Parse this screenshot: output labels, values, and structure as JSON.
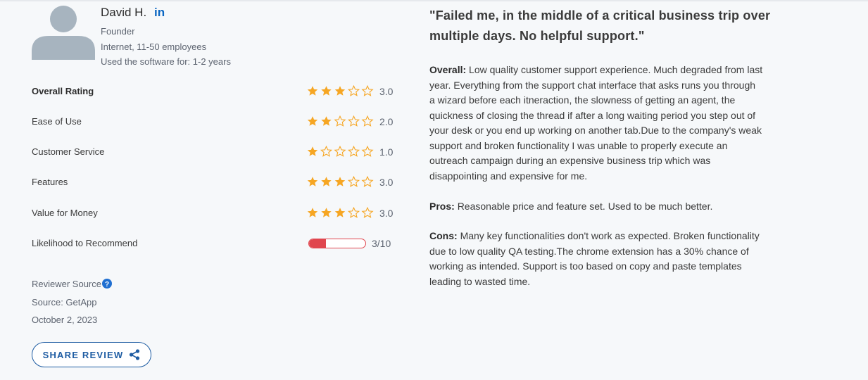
{
  "reviewer": {
    "name": "David H.",
    "linkedin_icon": "in",
    "role": "Founder",
    "company": "Internet, 11-50 employees",
    "usage": "Used the software for: 1-2 years"
  },
  "ratings": [
    {
      "label": "Overall Rating",
      "stars": 3,
      "value": "3.0"
    },
    {
      "label": "Ease of Use",
      "stars": 2,
      "value": "2.0"
    },
    {
      "label": "Customer Service",
      "stars": 1,
      "value": "1.0"
    },
    {
      "label": "Features",
      "stars": 3,
      "value": "3.0"
    },
    {
      "label": "Value for Money",
      "stars": 3,
      "value": "3.0"
    }
  ],
  "likelihood": {
    "label": "Likelihood to Recommend",
    "value": "3/10",
    "fraction": 0.3
  },
  "source": {
    "label": "Reviewer Source",
    "source_text": "Source: GetApp",
    "date": "October 2, 2023"
  },
  "share_button": {
    "label": "SHARE REVIEW"
  },
  "review": {
    "title_lines": [
      "\"Failed me, in the middle of a critical business trip over",
      "multiple days. No helpful support.\""
    ],
    "overall_label": "Overall:",
    "overall_lines": [
      "Low quality customer support experience. Much degraded from last",
      "year. Everything from the support chat interface that asks runs you through",
      "a wizard before each itneraction, the slowness of getting an agent, the",
      "quickness of closing the thread if after a long waiting period you step out of",
      "your desk or you end up working on another tab.Due to the company's weak",
      "support and broken functionality I was unable to properly execute an",
      "outreach campaign during an expensive business trip which was",
      "disappointing and expensive for me."
    ],
    "pros_label": "Pros:",
    "pros_text": "Reasonable price and feature set. Used to be much better.",
    "cons_label": "Cons:",
    "cons_lines": [
      "Many key functionalities don't work as expected. Broken functionality",
      "due to low quality QA testing.The chrome extension has a 30% chance of",
      "working as intended. Support is too based on copy and paste templates",
      "leading to wasted time."
    ]
  },
  "colors": {
    "star": "#f6a623",
    "bar": "#e0464e",
    "accent": "#1f5da3",
    "linkedin": "#0a66c2"
  }
}
